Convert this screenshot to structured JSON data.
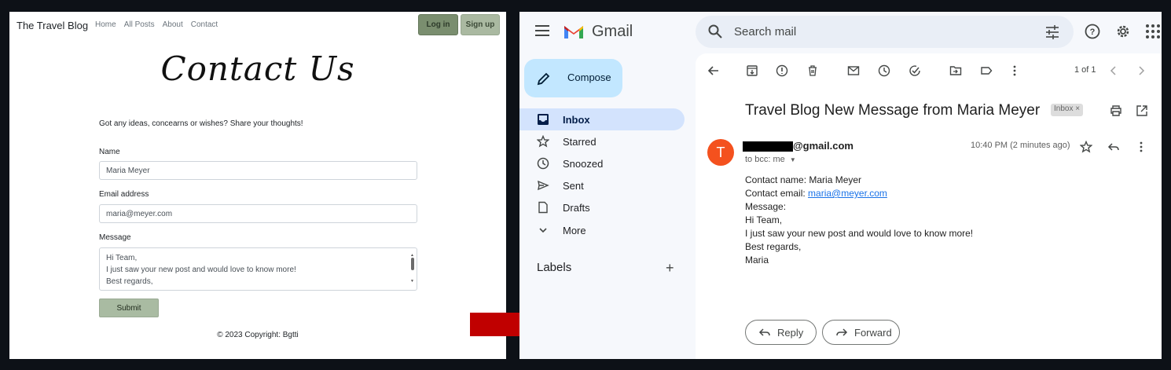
{
  "blog": {
    "brand": "The Travel Blog",
    "nav": [
      "Home",
      "All Posts",
      "About",
      "Contact"
    ],
    "login_label": "Log in",
    "signup_label": "Sign up",
    "title": "Contact Us",
    "intro": "Got any ideas, concearns or wishes? Share your thoughts!",
    "name_label": "Name",
    "name_value": "Maria Meyer",
    "email_label": "Email address",
    "email_value": "maria@meyer.com",
    "message_label": "Message",
    "message_lines": [
      "Hi Team,",
      "I just saw your new post and would love to know more!",
      "Best regards,"
    ],
    "submit_label": "Submit",
    "footer": "© 2023 Copyright: Bgtti"
  },
  "gmail": {
    "app_name": "Gmail",
    "search_placeholder": "Search mail",
    "compose_label": "Compose",
    "nav": [
      {
        "label": "Inbox",
        "icon": "inbox-icon",
        "active": true
      },
      {
        "label": "Starred",
        "icon": "star-icon"
      },
      {
        "label": "Snoozed",
        "icon": "clock-icon"
      },
      {
        "label": "Sent",
        "icon": "send-icon"
      },
      {
        "label": "Drafts",
        "icon": "draft-icon"
      },
      {
        "label": "More",
        "icon": "chevron-down-icon"
      }
    ],
    "labels_header": "Labels",
    "pager": "1 of 1",
    "subject": "Travel Blog New Message from Maria Meyer",
    "chip": "Inbox ×",
    "avatar_letter": "T",
    "sender_suffix": "@gmail.com",
    "to": "to bcc: me",
    "time": "10:40 PM (2 minutes ago)",
    "body": {
      "line1": "Contact name: Maria Meyer",
      "line2_prefix": "Contact email: ",
      "line2_link": "maria@meyer.com",
      "line3": "Message:",
      "line4": "Hi Team,",
      "line5": "I just saw your new post and would love to know more!",
      "line6": "Best regards,",
      "line7": "Maria"
    },
    "reply_label": "Reply",
    "forward_label": "Forward"
  },
  "colors": {
    "arrow": "#c00000",
    "compose": "#c2e7ff",
    "active_nav": "#d3e3fd",
    "avatar": "#f4511e",
    "login_button": "#7a8e6f"
  }
}
